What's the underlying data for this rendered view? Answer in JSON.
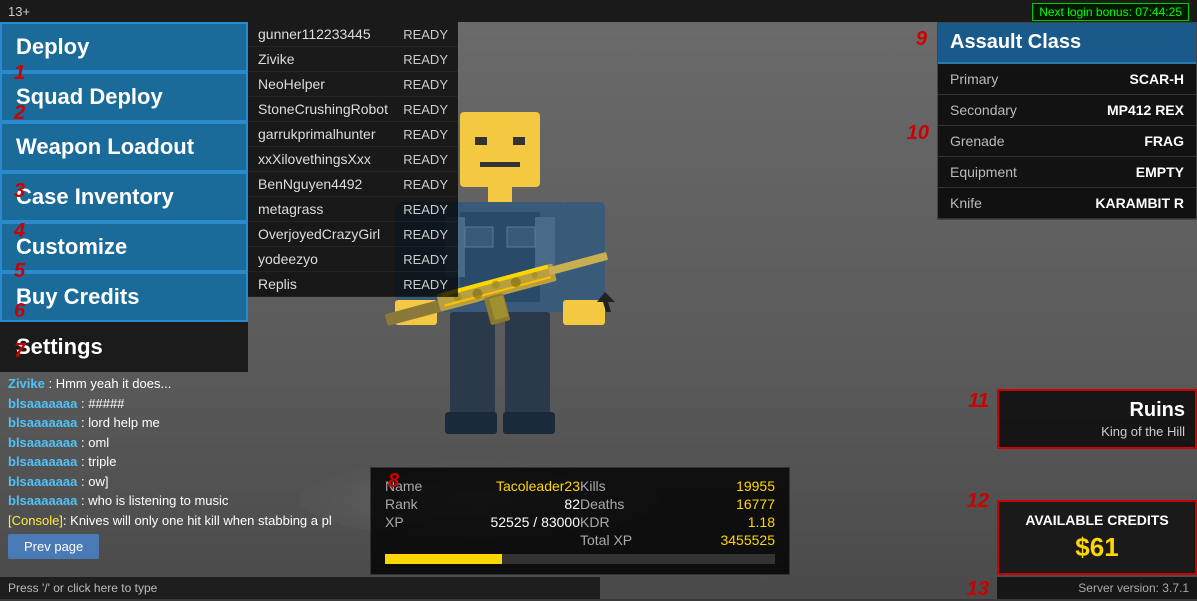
{
  "topbar": {
    "rating": "13+",
    "login_bonus": "Next login bonus: 07:44:25"
  },
  "sidebar": {
    "items": [
      {
        "id": "deploy",
        "label": "Deploy",
        "active": true,
        "number": "1"
      },
      {
        "id": "squad-deploy",
        "label": "Squad Deploy",
        "active": true,
        "number": "2"
      },
      {
        "id": "weapon-loadout",
        "label": "Weapon Loadout",
        "active": true,
        "number": "3"
      },
      {
        "id": "case-inventory",
        "label": "Case Inventory",
        "active": true,
        "number": "4"
      },
      {
        "id": "customize",
        "label": "Customize",
        "active": true,
        "number": "5"
      },
      {
        "id": "buy-credits",
        "label": "Buy Credits",
        "active": true,
        "number": "6"
      },
      {
        "id": "settings",
        "label": "Settings",
        "active": false,
        "number": "7"
      }
    ]
  },
  "players": [
    {
      "name": "gunner112233445",
      "status": "READY"
    },
    {
      "name": "Zivike",
      "status": "READY"
    },
    {
      "name": "NeoHelper",
      "status": "READY"
    },
    {
      "name": "StoneCrushingRobot",
      "status": "READY"
    },
    {
      "name": "garrukprimalhunter",
      "status": "READY"
    },
    {
      "name": "xxXilovethingsXxx",
      "status": "READY"
    },
    {
      "name": "BenNguyen4492",
      "status": "READY"
    },
    {
      "name": "metagrass",
      "status": "READY"
    },
    {
      "name": "OverjoyedCrazyGirl",
      "status": "READY"
    },
    {
      "name": "yodeezyo",
      "status": "READY"
    },
    {
      "name": "Replis",
      "status": "READY"
    }
  ],
  "chat": [
    {
      "name": "Zivike",
      "message": "Hmm yeah it does...",
      "type": "user"
    },
    {
      "name": "blsaaaaaaa",
      "message": "#####",
      "type": "user"
    },
    {
      "name": "blsaaaaaaa",
      "message": "lord help me",
      "type": "user"
    },
    {
      "name": "blsaaaaaaa",
      "message": "oml",
      "type": "user"
    },
    {
      "name": "blsaaaaaaa",
      "message": "triple",
      "type": "user"
    },
    {
      "name": "blsaaaaaaa",
      "message": "ow]",
      "type": "user"
    },
    {
      "name": "blsaaaaaaa",
      "message": "who is listening to music",
      "type": "user"
    },
    {
      "name": "[Console]",
      "message": "Knives will only one hit kill when stabbing a pl",
      "type": "console"
    }
  ],
  "prev_page_btn": "Prev page",
  "press_hint": "Press '/' or click here to type",
  "stats": {
    "name_label": "Name",
    "name_value": "Tacoleader23",
    "rank_label": "Rank",
    "rank_value": "82",
    "xp_label": "XP",
    "xp_value": "52525 / 83000",
    "xp_percent": 30,
    "kills_label": "Kills",
    "kills_value": "19955",
    "deaths_label": "Deaths",
    "deaths_value": "16777",
    "kdr_label": "KDR",
    "kdr_value": "1.18",
    "total_xp_label": "Total XP",
    "total_xp_value": "3455525"
  },
  "assault_class": {
    "title": "Assault Class",
    "rows": [
      {
        "label": "Primary",
        "value": "SCAR-H"
      },
      {
        "label": "Secondary",
        "value": "MP412 REX"
      },
      {
        "label": "Grenade",
        "value": "FRAG"
      },
      {
        "label": "Equipment",
        "value": "EMPTY"
      },
      {
        "label": "Knife",
        "value": "KARAMBIT R"
      }
    ]
  },
  "map": {
    "name": "Ruins",
    "mode": "King of the Hill"
  },
  "credits": {
    "label": "AVAILABLE CREDITS",
    "amount": "$61"
  },
  "server": {
    "version": "Server version: 3.7.1"
  },
  "annotations": {
    "n1": "1",
    "n2": "2",
    "n3": "3",
    "n4": "4",
    "n5": "5",
    "n6": "6",
    "n7": "7",
    "n8": "8",
    "n9": "9",
    "n10": "10",
    "n11": "11",
    "n12": "12",
    "n13": "13"
  }
}
